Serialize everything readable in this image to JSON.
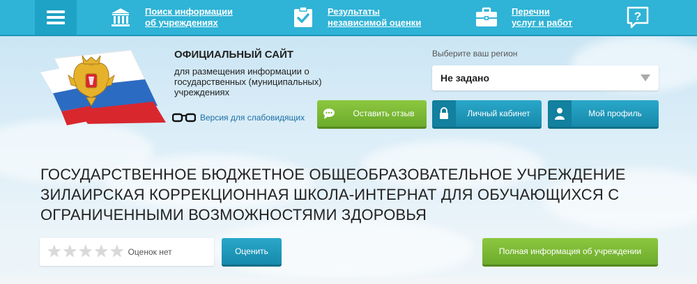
{
  "nav": {
    "menu_icon": "hamburger-icon",
    "items": [
      {
        "line1": "Поиск информации",
        "line2": "об учреждениях",
        "icon": "institution-icon"
      },
      {
        "line1": "Результаты",
        "line2": "независимой оценки",
        "icon": "checkmark-clipboard-icon"
      },
      {
        "line1": "Перечни",
        "line2": "услуг и работ",
        "icon": "briefcase-icon"
      }
    ],
    "help_icon": "question-icon"
  },
  "header": {
    "title": "ОФИЦИАЛЬНЫЙ САЙТ",
    "description": "для размещения информации о государственных (муниципальных) учреждениях",
    "low_vision_label": "Версия для слабовидящих"
  },
  "region": {
    "label": "Выберите ваш регион",
    "selected": "Не задано"
  },
  "buttons": {
    "feedback": "Оставить отзыв",
    "cabinet": "Личный кабинет",
    "profile": "Мой профиль",
    "rate": "Оценить",
    "full_info": "Полная информация об учреждении"
  },
  "organization": {
    "name": "ГОСУДАРСТВЕННОЕ БЮДЖЕТНОЕ ОБЩЕОБРАЗОВАТЕЛЬНОЕ УЧРЕЖДЕНИЕ ЗИЛАИРСКАЯ КОРРЕКЦИОННАЯ ШКОЛА-ИНТЕРНАТ ДЛЯ ОБУЧАЮЩИХСЯ С ОГРАНИЧЕННЫМИ ВОЗМОЖНОСТЯМИ ЗДОРОВЬЯ"
  },
  "rating": {
    "stars_filled": 0,
    "stars_total": 5,
    "text": "Оценок нет"
  },
  "colors": {
    "topbar": "#2fb3d6",
    "green_button": "#7cbb36",
    "teal_button": "#1f9abd"
  }
}
